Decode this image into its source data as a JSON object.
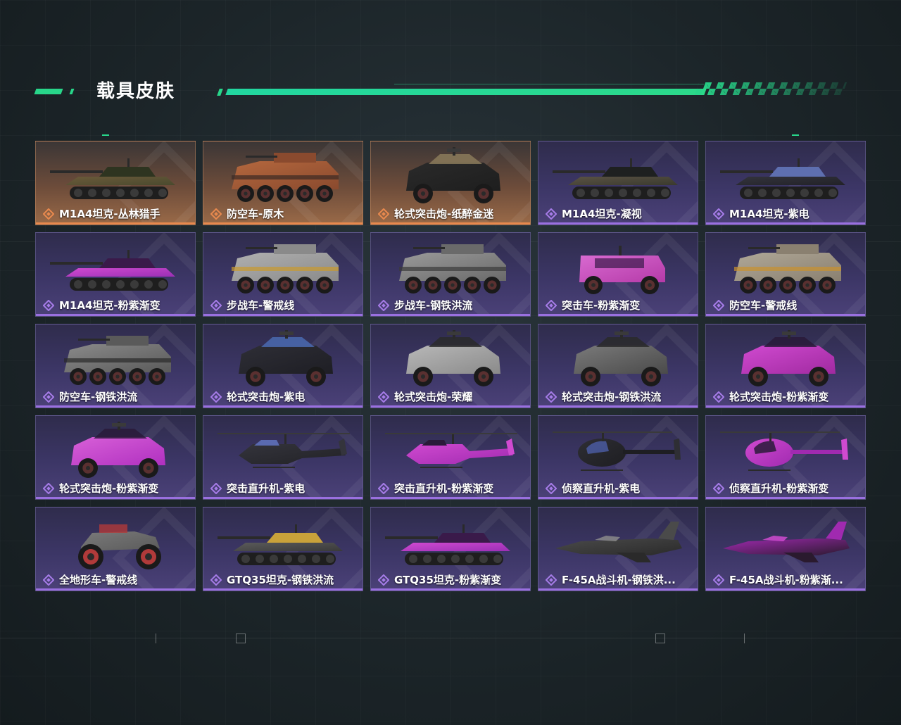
{
  "header": {
    "title": "载具皮肤"
  },
  "colors": {
    "accent": "#28d68a",
    "purple_rarity": "#a67ce8",
    "orange_rarity": "#e8894e"
  },
  "skins": [
    {
      "label": "M1A4坦克-丛林猎手",
      "rarity": "orange",
      "kind": "tank",
      "palette": [
        "#4a4a2e",
        "#6b5a3a",
        "#2e3420"
      ]
    },
    {
      "label": "防空车-原木",
      "rarity": "orange",
      "kind": "apc",
      "palette": [
        "#8a4a2e",
        "#b5683e",
        "#3a2a24"
      ]
    },
    {
      "label": "轮式突击炮-纸醉金迷",
      "rarity": "orange",
      "kind": "jeep",
      "palette": [
        "#1e1e1e",
        "#2a2a2a",
        "#8a7a5a"
      ]
    },
    {
      "label": "M1A4坦克-凝视",
      "rarity": "purple",
      "kind": "tank",
      "palette": [
        "#3a3a2e",
        "#5a5244",
        "#1e2020"
      ]
    },
    {
      "label": "M1A4坦克-紫电",
      "rarity": "purple",
      "kind": "tank",
      "palette": [
        "#222228",
        "#33333c",
        "#5e6fb0"
      ]
    },
    {
      "label": "M1A4坦克-粉紫渐变",
      "rarity": "purple",
      "kind": "tank",
      "palette": [
        "#9b2fb5",
        "#d04ad0",
        "#3a1a4a"
      ]
    },
    {
      "label": "步战车-警戒线",
      "rarity": "purple",
      "kind": "apc",
      "palette": [
        "#8a8a8a",
        "#b0b0b0",
        "#c99a2e"
      ]
    },
    {
      "label": "步战车-钢铁洪流",
      "rarity": "purple",
      "kind": "apc",
      "palette": [
        "#6a6a6a",
        "#9a9a9a",
        "#3a3a3a"
      ]
    },
    {
      "label": "突击车-粉紫渐变",
      "rarity": "purple",
      "kind": "truck",
      "palette": [
        "#b53aa8",
        "#d86ad0",
        "#3a1a4a"
      ]
    },
    {
      "label": "防空车-警戒线",
      "rarity": "purple",
      "kind": "apc",
      "palette": [
        "#8a8070",
        "#b0a898",
        "#c9922e"
      ]
    },
    {
      "label": "防空车-钢铁洪流",
      "rarity": "purple",
      "kind": "apc",
      "palette": [
        "#5a5a5a",
        "#8a8a8a",
        "#2a2a2a"
      ]
    },
    {
      "label": "轮式突击炮-紫电",
      "rarity": "purple",
      "kind": "jeep",
      "palette": [
        "#1e1e24",
        "#2e2e36",
        "#4a6ab0"
      ]
    },
    {
      "label": "轮式突击炮-荣耀",
      "rarity": "purple",
      "kind": "jeep",
      "palette": [
        "#8a8a8a",
        "#b8b8b8",
        "#2a2a2a"
      ]
    },
    {
      "label": "轮式突击炮-钢铁洪流",
      "rarity": "purple",
      "kind": "jeep",
      "palette": [
        "#4a4a4a",
        "#7a7a7a",
        "#2a2a2a"
      ]
    },
    {
      "label": "轮式突击炮-粉紫渐变",
      "rarity": "purple",
      "kind": "jeep",
      "palette": [
        "#a02aa0",
        "#d04ad0",
        "#2a1a3a"
      ]
    },
    {
      "label": "轮式突击炮-粉紫渐变",
      "rarity": "purple",
      "kind": "jeep",
      "palette": [
        "#b030c0",
        "#d860d8",
        "#2a1a3a"
      ]
    },
    {
      "label": "突击直升机-紫电",
      "rarity": "purple",
      "kind": "heli",
      "palette": [
        "#222226",
        "#34343c",
        "#5a6ab0"
      ]
    },
    {
      "label": "突击直升机-粉紫渐变",
      "rarity": "purple",
      "kind": "heli",
      "palette": [
        "#a02ab0",
        "#d04ad0",
        "#2a1a3a"
      ]
    },
    {
      "label": "侦察直升机-紫电",
      "rarity": "purple",
      "kind": "scout",
      "palette": [
        "#1e1e22",
        "#2e2e34",
        "#4a5aa0"
      ]
    },
    {
      "label": "侦察直升机-粉紫渐变",
      "rarity": "purple",
      "kind": "scout",
      "palette": [
        "#a02ab0",
        "#d04ad0",
        "#2a1a3a"
      ]
    },
    {
      "label": "全地形车-警戒线",
      "rarity": "purple",
      "kind": "atv",
      "palette": [
        "#5a5a5a",
        "#7a7a7a",
        "#b03a3a"
      ]
    },
    {
      "label": "GTQ35坦克-钢铁洪流",
      "rarity": "purple",
      "kind": "tank",
      "palette": [
        "#3a3a3a",
        "#5a5a5a",
        "#c9a23a"
      ]
    },
    {
      "label": "GTQ35坦克-粉紫渐变",
      "rarity": "purple",
      "kind": "tank",
      "palette": [
        "#9b2fb5",
        "#d04ad0",
        "#3a1a4a"
      ]
    },
    {
      "label": "F-45A战斗机-钢铁洪...",
      "rarity": "purple",
      "kind": "jet",
      "palette": [
        "#2a2a2a",
        "#4a4a4a",
        "#8a8a8a"
      ]
    },
    {
      "label": "F-45A战斗机-粉紫渐...",
      "rarity": "purple",
      "kind": "jet",
      "palette": [
        "#2a1a2e",
        "#a02ab0",
        "#d04ad0"
      ]
    }
  ]
}
